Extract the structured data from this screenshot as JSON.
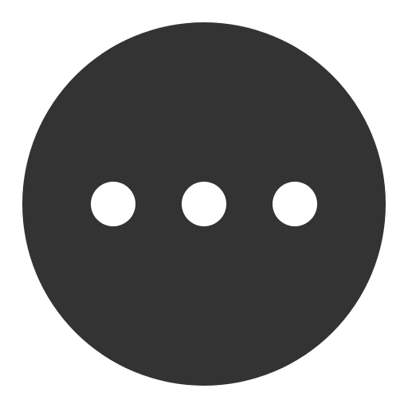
{
  "icon": {
    "name": "more-horizontal-circle-icon",
    "glyph": "ellipsis",
    "dot_count": 3,
    "colors": {
      "circle": "#333333",
      "dots": "#ffffff",
      "background": "#ffffff"
    }
  }
}
